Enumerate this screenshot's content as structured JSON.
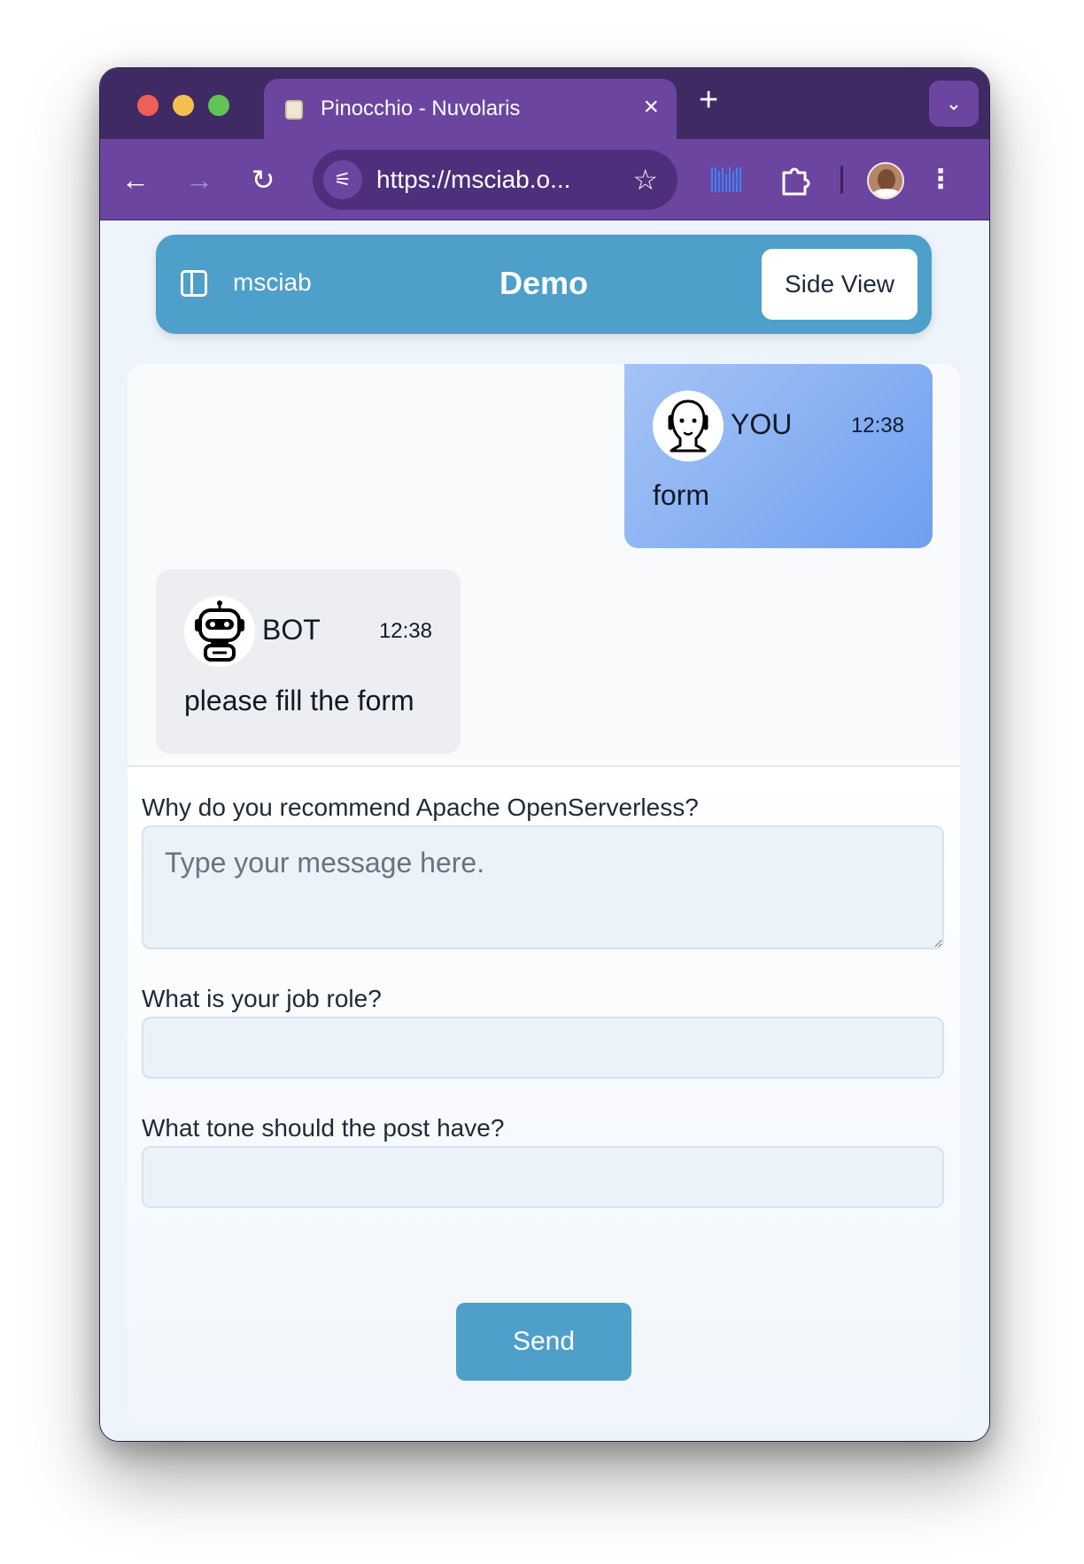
{
  "browser": {
    "tab": {
      "title": "Pinocchio - Nuvolaris",
      "close_icon": "×"
    },
    "new_tab_icon": "+",
    "tab_menu_icon": "⌄",
    "toolbar": {
      "back_icon": "←",
      "forward_icon": "→",
      "reload_icon": "↻",
      "url": "https://msciab.o...",
      "tune_icon": "⚟",
      "star_icon": "☆",
      "more_icon": "⋮"
    }
  },
  "header": {
    "brand": "msciab",
    "title": "Demo",
    "side_view_label": "Side View"
  },
  "messages": [
    {
      "sender": "YOU",
      "time": "12:38",
      "text": "form"
    },
    {
      "sender": "BOT",
      "time": "12:38",
      "text": "please fill the form"
    }
  ],
  "form": {
    "fields": [
      {
        "label": "Why do you recommend Apache OpenServerless?",
        "placeholder": "Type your message here.",
        "value": ""
      },
      {
        "label": "What is your job role?",
        "value": ""
      },
      {
        "label": "What tone should the post have?",
        "value": ""
      }
    ],
    "send_label": "Send"
  },
  "colors": {
    "tab_strip": "#3f2a63",
    "toolbar": "#6c45a1",
    "header": "#4e9fc9",
    "send_button": "#4e9fc9"
  }
}
